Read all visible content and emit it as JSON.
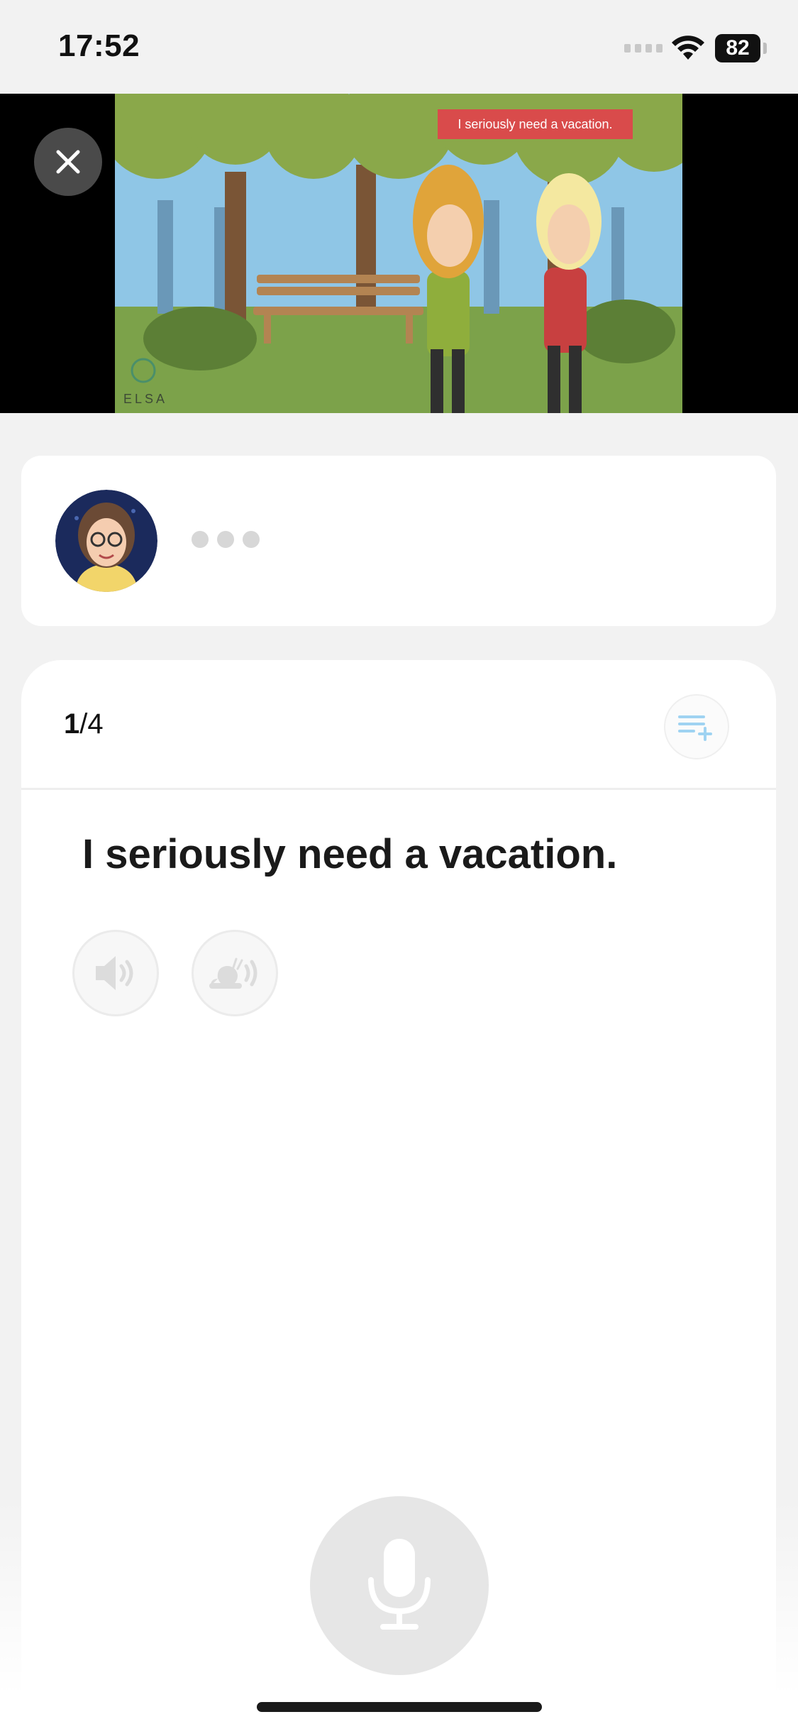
{
  "status_bar": {
    "time": "17:52",
    "battery_level": "82",
    "icons": [
      "cellular-signal-icon",
      "wifi-icon",
      "battery-icon"
    ]
  },
  "video": {
    "banner_text": "I seriously need a vacation.",
    "watermark": "ELSA",
    "close_icon": "close-icon"
  },
  "speaker": {
    "avatar_icon": "tutor-avatar",
    "typing_indicator": "typing-dots-icon"
  },
  "exercise": {
    "progress_current": "1",
    "progress_total": "/4",
    "sentence": "I seriously need a vacation.",
    "playlist_icon": "playlist-add-icon",
    "audio_buttons": [
      {
        "icon": "speaker-icon"
      },
      {
        "icon": "slow-speaker-icon"
      }
    ],
    "mic_icon": "microphone-icon"
  },
  "colors": {
    "background": "#f2f2f2",
    "card": "#ffffff",
    "accent_light_blue": "#9fd3f2",
    "disabled_grey": "#e6e6e6",
    "banner_red": "#d94b4b"
  }
}
